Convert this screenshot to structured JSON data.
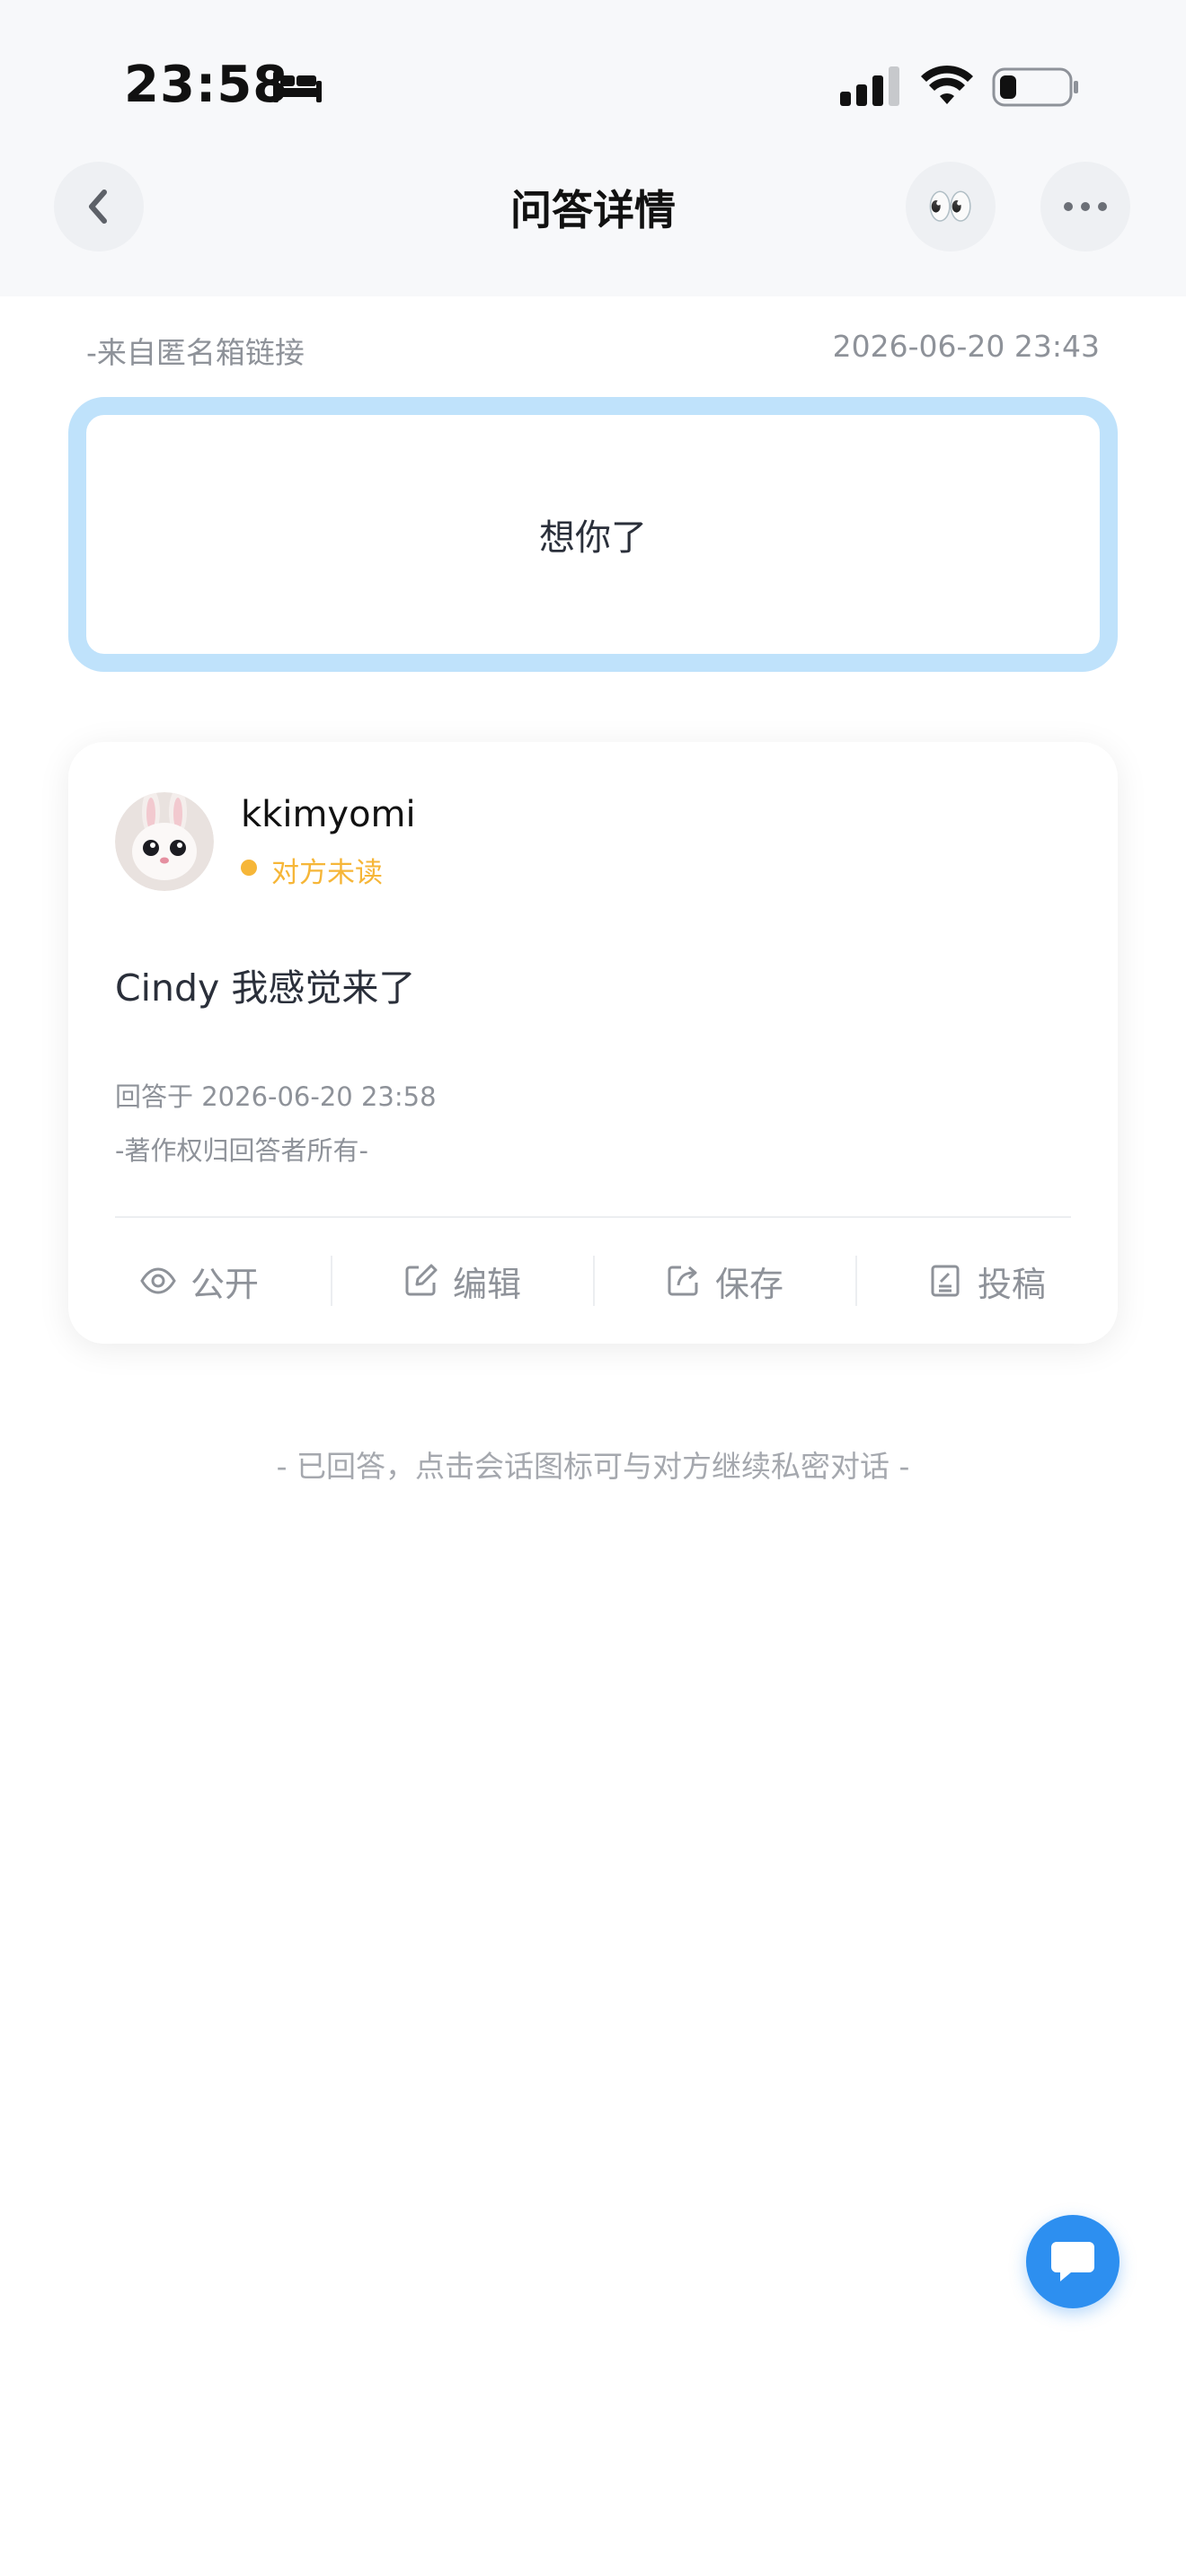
{
  "status_bar": {
    "time": "23:58",
    "icons": [
      "bed-icon",
      "signal-icon",
      "wifi-icon",
      "battery-icon"
    ]
  },
  "nav": {
    "title": "问答详情",
    "back_icon": "chevron-left-icon",
    "eyes_icon": "👀",
    "more_icon": "more-dots-icon"
  },
  "question": {
    "source": "-来自匿名箱链接",
    "time": "2026-06-20 23:43",
    "text": "想你了"
  },
  "answer": {
    "username": "kkimyomi",
    "read_status": "对方未读",
    "text": "Cindy 我感觉来了",
    "answer_time": "回答于 2026-06-20 23:58",
    "copyright": "-著作权归回答者所有-",
    "actions": [
      {
        "label": "公开",
        "icon": "eye-icon"
      },
      {
        "label": "编辑",
        "icon": "edit-icon"
      },
      {
        "label": "保存",
        "icon": "share-icon"
      },
      {
        "label": "投稿",
        "icon": "document-icon"
      }
    ]
  },
  "footer_note": "- 已回答，点击会话图标可与对方继续私密对话 -",
  "colors": {
    "accent": "#2d8ff0",
    "question_border": "#bfe2fb",
    "unread": "#f6b638",
    "muted_text": "#8e9299"
  }
}
